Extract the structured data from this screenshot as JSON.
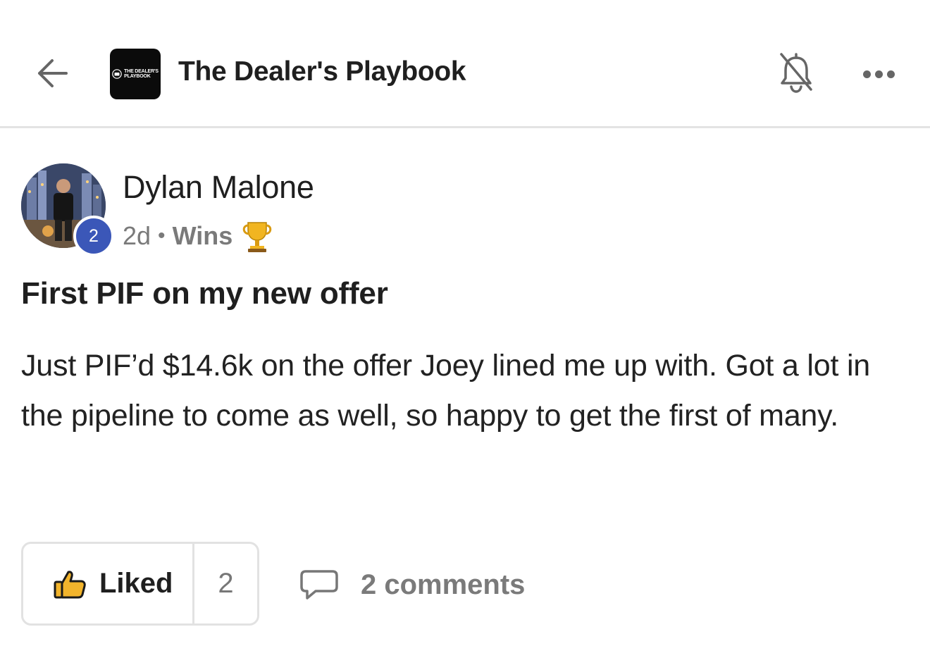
{
  "header": {
    "group_name": "The Dealer's Playbook",
    "logo_text_line1": "THE DEALER'S",
    "logo_text_line2": "PLAYBOOK",
    "back_icon": "arrow-left-icon",
    "notification_icon": "bell-off-icon",
    "more_icon": "more-horizontal-icon"
  },
  "post": {
    "author": {
      "name": "Dylan Malone",
      "level": "2"
    },
    "time_ago": "2d",
    "separator": "•",
    "category": "Wins",
    "category_icon": "trophy-icon",
    "title": "First PIF on my new offer",
    "body": "Just PIF’d $14.6k on the offer Joey lined me up with. Got a lot in the pipeline to come as well, so happy to get the first of many."
  },
  "actions": {
    "like_label": "Liked",
    "like_count": "2",
    "comments_label": "2 comments"
  },
  "colors": {
    "level_badge": "#3b57b8",
    "logo_bg": "#0b0b0b",
    "divider": "#e3e3e3",
    "like_icon_fill": "#f2b42c"
  }
}
